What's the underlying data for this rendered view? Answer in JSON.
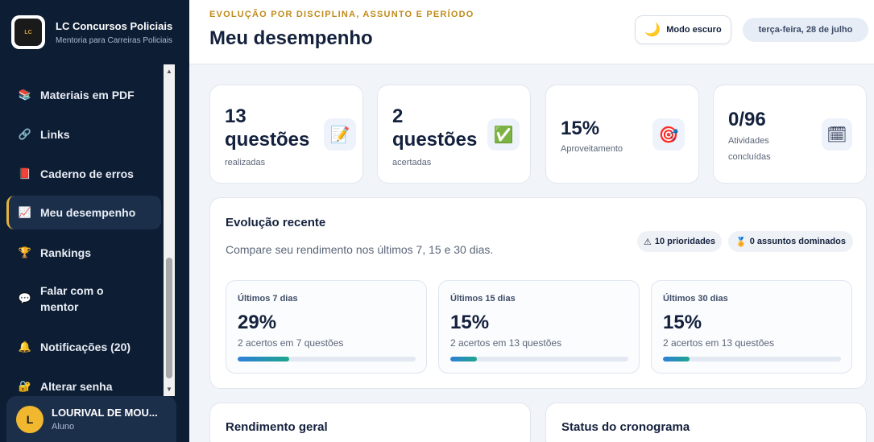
{
  "brand": {
    "logo_text": "LC",
    "title": "LC Concursos Policiais",
    "subtitle": "Mentoria para Carreiras Policiais"
  },
  "sidebar": {
    "items": [
      {
        "icon": "books-icon",
        "glyph": "📚",
        "label": "Materiais em PDF"
      },
      {
        "icon": "link-icon",
        "glyph": "🔗",
        "label": "Links"
      },
      {
        "icon": "red-book-icon",
        "glyph": "📕",
        "label": "Caderno de erros"
      },
      {
        "icon": "chart-icon",
        "glyph": "📈",
        "label": "Meu desempenho",
        "active": true
      },
      {
        "icon": "trophy-icon",
        "glyph": "🏆",
        "label": "Rankings"
      },
      {
        "icon": "chat-icon",
        "glyph": "💬",
        "label": "Falar com o mentor"
      },
      {
        "icon": "bell-icon",
        "glyph": "🔔",
        "label": "Notificações (20)"
      },
      {
        "icon": "lock-icon",
        "glyph": "🔐",
        "label": "Alterar senha"
      }
    ]
  },
  "user": {
    "initial": "L",
    "name": "LOURIVAL DE MOU...",
    "role": "Aluno"
  },
  "header": {
    "eyebrow": "EVOLUÇÃO POR DISCIPLINA, ASSUNTO E PERÍODO",
    "title": "Meu desempenho",
    "dark_mode_label": "Modo escuro",
    "date": "terça-feira, 28 de julho"
  },
  "stats": [
    {
      "value": "13 questões",
      "label": "realizadas",
      "icon": "memo-icon",
      "glyph": "📝"
    },
    {
      "value": "2 questões",
      "label": "acertadas",
      "icon": "check-icon",
      "glyph": "✅"
    },
    {
      "value": "15%",
      "label": "Aproveitamento",
      "icon": "target-icon",
      "glyph": "🎯"
    },
    {
      "value": "0/96",
      "label": "Atividades concluídas",
      "icon": "calendar-icon",
      "glyph": "🗓"
    }
  ],
  "evolution": {
    "title": "Evolução recente",
    "subtitle": "Compare seu rendimento nos últimos 7, 15 e 30 dias.",
    "chips": [
      {
        "icon": "warning-icon",
        "glyph": "⚠",
        "label": "10 prioridades"
      },
      {
        "icon": "medal-icon",
        "glyph": "🏅",
        "label": "0 assuntos dominados"
      }
    ],
    "periods": [
      {
        "label": "Últimos 7 dias",
        "pct": "29%",
        "detail": "2 acertos em 7 questões",
        "progress": 0.29
      },
      {
        "label": "Últimos 15 dias",
        "pct": "15%",
        "detail": "2 acertos em 13 questões",
        "progress": 0.15
      },
      {
        "label": "Últimos 30 dias",
        "pct": "15%",
        "detail": "2 acertos em 13 questões",
        "progress": 0.15
      }
    ]
  },
  "bottom": {
    "rendimento_title": "Rendimento geral",
    "cronograma_title": "Status do cronograma"
  }
}
